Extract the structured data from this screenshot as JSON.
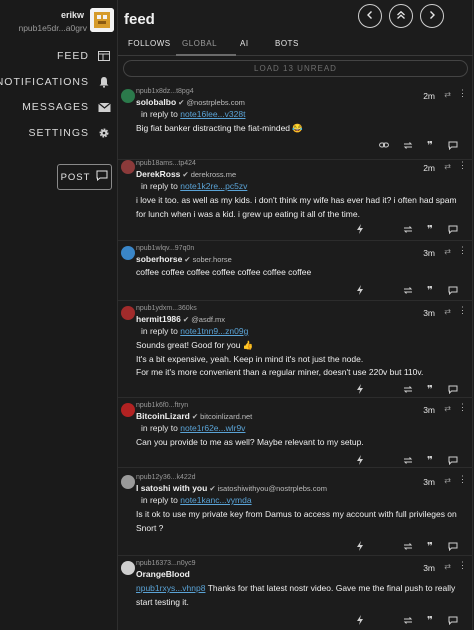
{
  "account": {
    "name": "erikw",
    "npub": "npub1e5dr...a0grv"
  },
  "nav": [
    {
      "label": "FEED",
      "icon": "feed-icon"
    },
    {
      "label": "NOTIFICATIONS",
      "icon": "bell-icon"
    },
    {
      "label": "MESSAGES",
      "icon": "mail-icon"
    },
    {
      "label": "SETTINGS",
      "icon": "gear-icon"
    }
  ],
  "post_label": "POST",
  "header": {
    "title": "feed"
  },
  "tabs": [
    "FOLLOWS",
    "GLOBAL",
    "AI",
    "BOTS"
  ],
  "active_tab": "GLOBAL",
  "load_label": "LOAD 13 UNREAD",
  "notes": [
    {
      "npub": "npub1x8dz...t8pg4",
      "author": "solobalbo",
      "nip05": "@nostrplebs.com",
      "time": "2m",
      "reply_prefix": "in reply to",
      "reply_link": "note16lee...v328t",
      "body": [
        "Big fiat banker distracting the fiat-minded 😂"
      ]
    },
    {
      "npub": "npub18ams...tp424",
      "author": "DerekRoss",
      "nip05": "derekross.me",
      "time": "2m",
      "reply_prefix": "in reply to",
      "reply_link": "note1k2re...pc5zv",
      "body": [
        "i love it too. as well as my kids. i don't think my wife has ever had it? i often had spam for lunch when i was a kid. i grew up eating it all of the time."
      ]
    },
    {
      "npub": "npub1wlqv...97q0n",
      "author": "soberhorse",
      "nip05": "sober.horse",
      "time": "3m",
      "body": [
        "coffee coffee coffee coffee coffee coffee coffee"
      ]
    },
    {
      "npub": "npub1ydxm...360ks",
      "author": "hermit1986",
      "nip05": "@asdf.mx",
      "time": "3m",
      "reply_prefix": "in reply to",
      "reply_link": "note1tnn9...zn09g",
      "body": [
        "Sounds great! Good for you 👍",
        "It's a bit expensive, yeah. Keep in mind it's not just the node.",
        "For me it's more convenient than a regular miner, doesn't use 220v but 110v."
      ]
    },
    {
      "npub": "npub1k6f0...ftryn",
      "author": "BitcoinLizard",
      "nip05": "bitcoinlizard.net",
      "time": "3m",
      "reply_prefix": "in reply to",
      "reply_link": "note1r62e...wlr9v",
      "body": [
        "Can you provide to me as well? Maybe relevant to my setup."
      ]
    },
    {
      "npub": "npub12y36...k422d",
      "author": "I satoshi with you",
      "nip05": "isatoshiwithyou@nostrplebs.com",
      "time": "3m",
      "reply_prefix": "in reply to",
      "reply_link": "note1kanc...vymda",
      "body": [
        "Is it ok to use my private key from Damus to access my account with full privileges on Snort ?"
      ]
    },
    {
      "npub": "npub16373...n0yc9",
      "author": "OrangeBlood",
      "nip05": "",
      "time": "3m",
      "mention": "npub1rxys...vhnp8",
      "body_after_mention": "Thanks for that latest nostr video. Gave me the final push to really start testing it."
    }
  ],
  "colors": {
    "link": "#5aa3d6",
    "background": "#1c1c1c",
    "text": "#e6e6e6"
  }
}
